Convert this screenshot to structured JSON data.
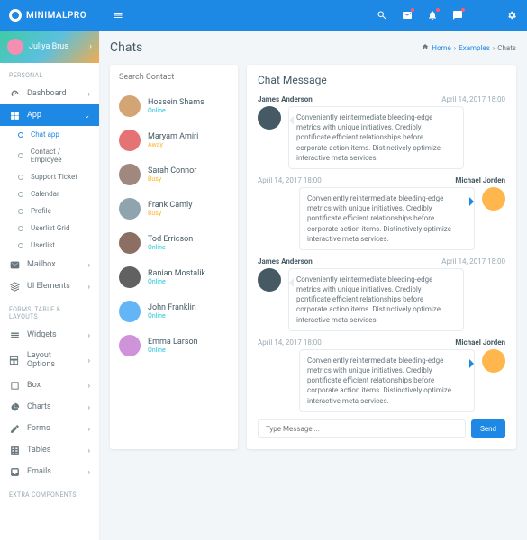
{
  "brand": "MINIMALPRO",
  "user": {
    "name": "Juliya Brus"
  },
  "page": {
    "title": "Chats"
  },
  "breadcrumb": {
    "home": "Home",
    "l1": "Examples",
    "l2": "Chats"
  },
  "sections": {
    "s1": "PERSONAL",
    "s2": "FORMS, TABLE & LAYOUTS",
    "s3": "EXTRA COMPONENTS"
  },
  "nav": {
    "dashboard": "Dashboard",
    "app": "App",
    "app_sub": {
      "chat": "Chat app",
      "contact": "Contact / Employee",
      "ticket": "Support Ticket",
      "cal": "Calendar",
      "profile": "Profile",
      "ugrid": "Userlist Grid",
      "ulist": "Userlist"
    },
    "mailbox": "Mailbox",
    "ui": "UI Elements",
    "widgets": "Widgets",
    "layout": "Layout Options",
    "box": "Box",
    "charts": "Charts",
    "forms": "Forms",
    "tables": "Tables",
    "emails": "Emails"
  },
  "contacts": {
    "search_ph": "Search Contact",
    "list": [
      {
        "name": "Hossein Shams",
        "status": "Online",
        "cls": "online"
      },
      {
        "name": "Maryam Amiri",
        "status": "Away",
        "cls": "away"
      },
      {
        "name": "Sarah Connor",
        "status": "Busy",
        "cls": "busy"
      },
      {
        "name": "Frank Camly",
        "status": "Busy",
        "cls": "busy"
      },
      {
        "name": "Tod Erricson",
        "status": "Online",
        "cls": "online"
      },
      {
        "name": "Ranian Mostalik",
        "status": "Online",
        "cls": "online"
      },
      {
        "name": "John Franklin",
        "status": "Online",
        "cls": "online"
      },
      {
        "name": "Emma Larson",
        "status": "Online",
        "cls": "online"
      }
    ]
  },
  "chat": {
    "title": "Chat Message",
    "input_ph": "Type Message ...",
    "send": "Send",
    "msgs": [
      {
        "side": "l",
        "name": "James Anderson",
        "time": "April 14, 2017 18:00",
        "text": "Conveniently reintermediate bleeding-edge metrics with unique initiatives. Credibly pontificate efficient relationships before corporate action items. Distinctively optimize interactive meta services."
      },
      {
        "side": "r",
        "name": "Michael Jorden",
        "time": "April 14, 2017 18:00",
        "text": "Conveniently reintermediate bleeding-edge metrics with unique initiatives. Credibly pontificate efficient relationships before corporate action items. Distinctively optimize interactive meta services."
      },
      {
        "side": "l",
        "name": "James Anderson",
        "time": "April 14, 2017 18:00",
        "text": "Conveniently reintermediate bleeding-edge metrics with unique initiatives. Credibly pontificate efficient relationships before corporate action items. Distinctively optimize interactive meta services."
      },
      {
        "side": "r",
        "name": "Michael Jorden",
        "time": "April 14, 2017 18:00",
        "text": "Conveniently reintermediate bleeding-edge metrics with unique initiatives. Credibly pontificate efficient relationships before corporate action items. Distinctively optimize interactive meta services."
      }
    ]
  },
  "avatars": {
    "user": "#f48fb1",
    "c0": "#d4a574",
    "c1": "#e57373",
    "c2": "#a1887f",
    "c3": "#90a4ae",
    "c4": "#8d6e63",
    "c5": "#616161",
    "c6": "#64b5f6",
    "c7": "#ce93d8",
    "m_l": "#455a64",
    "m_r": "#ffb74d"
  }
}
